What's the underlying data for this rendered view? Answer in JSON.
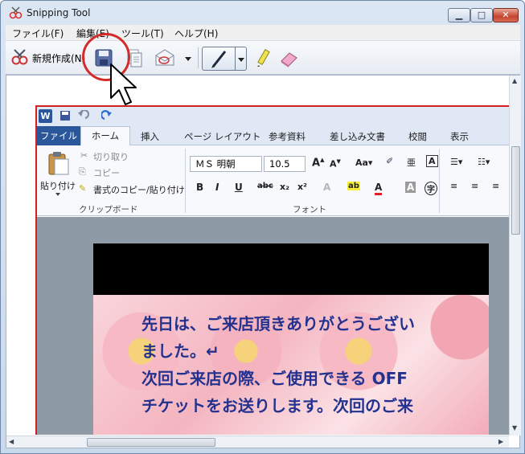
{
  "window": {
    "title": "Snipping Tool",
    "minimize": "▁",
    "maximize": "□",
    "close": "✕"
  },
  "menu": [
    "ファイル(F)",
    "編集(E)",
    "ツール(T)",
    "ヘルプ(H)"
  ],
  "toolbar": {
    "new_label": "新規作成(N)"
  },
  "word": {
    "logo": "W",
    "tabs": [
      "ファイル",
      "ホーム",
      "挿入",
      "ページ レイアウト",
      "参考資料",
      "差し込み文書",
      "校閲",
      "表示"
    ],
    "clipboard": {
      "paste_label": "貼り付け",
      "cut": "切り取り",
      "copy": "コピー",
      "format_painter": "書式のコピー/貼り付け",
      "group_label": "クリップボード"
    },
    "font": {
      "name": "ＭＳ 明朝",
      "size": "10.5",
      "group_label": "フォント"
    },
    "doc_lines": [
      "先日は、ご来店頂きありがとうござい",
      "ました。↵",
      "次回ご来店の際、ご使用できる OFF",
      "チケットをお送りします。次回のご来"
    ]
  },
  "colors": {
    "annotation": "#d42a2a",
    "word_blue": "#2b579a",
    "doc_text": "#23328f"
  },
  "icons": [
    "snipping-tool-icon",
    "new-snip-icon",
    "save-icon",
    "copy-icon",
    "send-icon",
    "pen-icon",
    "highlighter-icon",
    "eraser-icon",
    "cursor-icon"
  ]
}
